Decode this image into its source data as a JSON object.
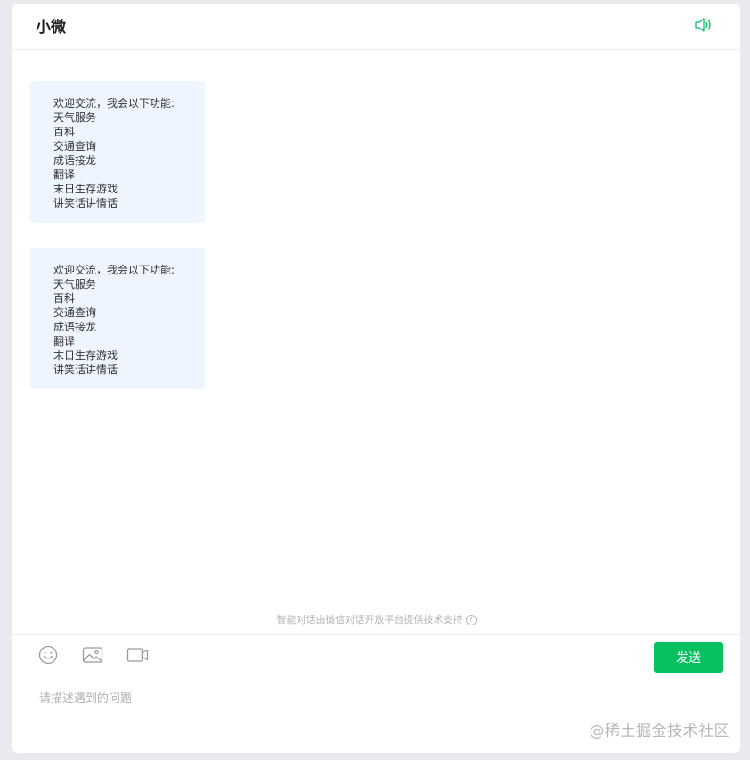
{
  "header": {
    "title": "小微",
    "speaker_icon": "speaker-icon"
  },
  "messages": [
    {
      "lines": [
        "欢迎交流，我会以下功能:",
        "天气服务",
        "百科",
        "交通查询",
        "成语接龙",
        "翻译",
        "末日生存游戏",
        "讲笑话讲情话"
      ]
    },
    {
      "lines": [
        "欢迎交流，我会以下功能:",
        "天气服务",
        "百科",
        "交通查询",
        "成语接龙",
        "翻译",
        "末日生存游戏",
        "讲笑话讲情话"
      ]
    }
  ],
  "footer": {
    "support_text": "智能对话由微信对话开放平台提供技术支持",
    "help_glyph": "?"
  },
  "toolbar": {
    "icons": [
      "emoji-icon",
      "image-icon",
      "video-icon"
    ],
    "send_label": "发送"
  },
  "input": {
    "placeholder": "请描述遇到的问题",
    "value": ""
  },
  "watermark": "@稀土掘金技术社区",
  "colors": {
    "accent": "#07c160",
    "bubble_bg": "#eff5fe",
    "speaker": "#07c160"
  }
}
